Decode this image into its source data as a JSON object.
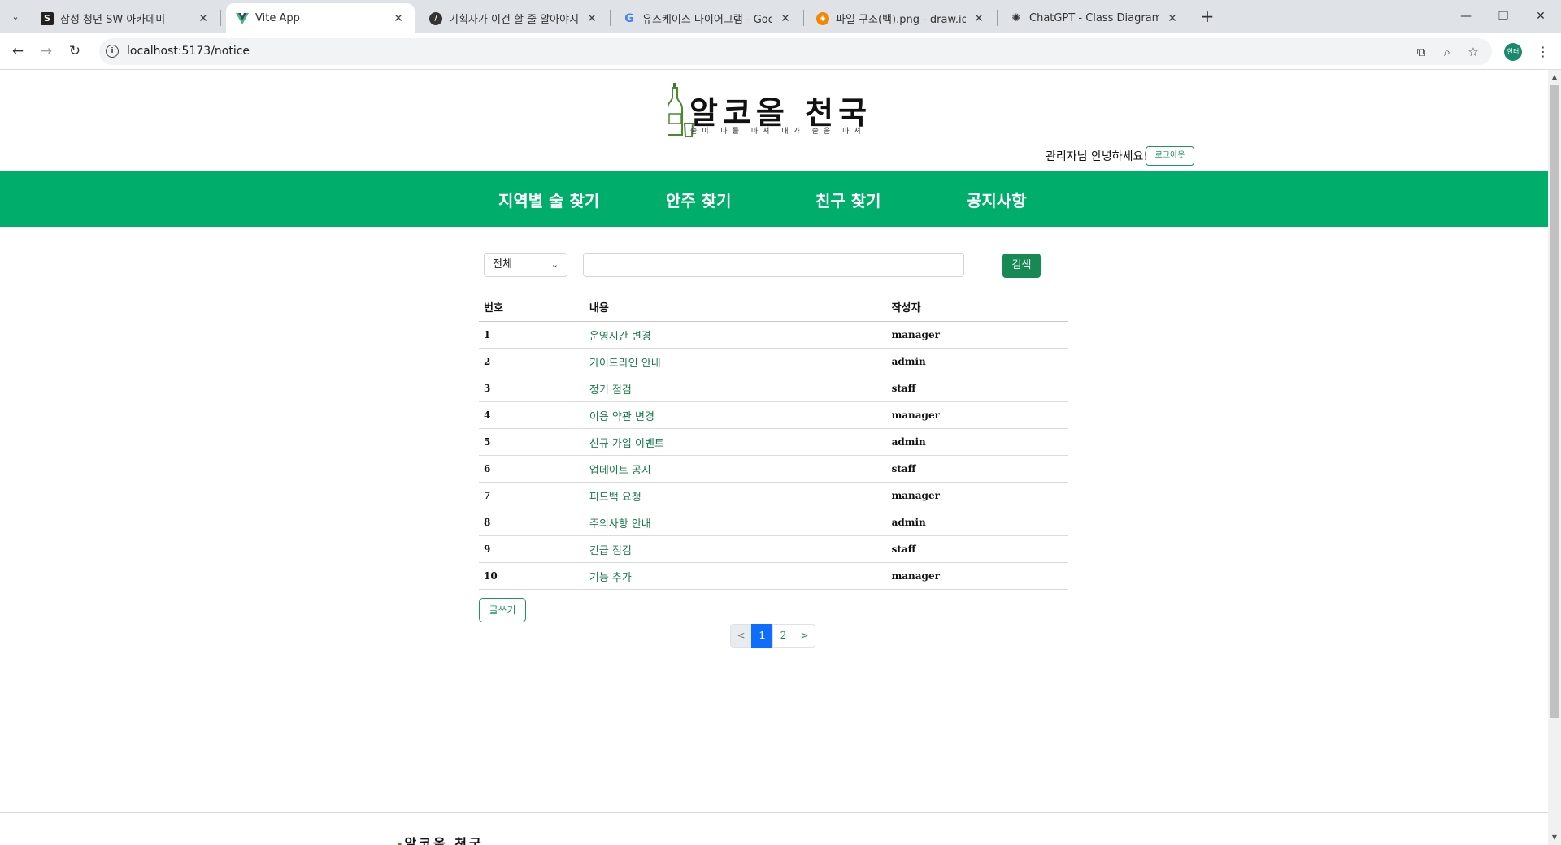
{
  "browser": {
    "tabs": [
      {
        "title": "삼성 청년 SW 아카데미",
        "favicon": "ssafy-icon"
      },
      {
        "title": "Vite App",
        "favicon": "vue-icon",
        "active": true
      },
      {
        "title": "기획자가 이건 할 줄 알아야지:",
        "favicon": "notion-icon"
      },
      {
        "title": "유즈케이스 다이어그램 - Goog",
        "favicon": "google-icon"
      },
      {
        "title": "파일 구조(백).png - draw.io",
        "favicon": "drawio-icon"
      },
      {
        "title": "ChatGPT - Class Diagram Crea",
        "favicon": "chatgpt-icon"
      }
    ],
    "url": "localhost:5173/notice",
    "profile_initials": "헌터"
  },
  "header": {
    "brand": "알코올 천국",
    "slogan": "술이 나를 마셔 내가 술을 마셔",
    "greeting": "관리자님 안녕하세요!",
    "logout_label": "로그아웃"
  },
  "nav": {
    "items": [
      "지역별 술 찾기",
      "안주 찾기",
      "친구 찾기",
      "공지사항"
    ]
  },
  "search": {
    "filter_value": "전체",
    "query": "",
    "button_label": "검색"
  },
  "table": {
    "headers": [
      "번호",
      "내용",
      "작성자"
    ],
    "rows": [
      {
        "num": "1",
        "content": "운영시간 변경",
        "writer": "manager"
      },
      {
        "num": "2",
        "content": "가이드라인 안내",
        "writer": "admin"
      },
      {
        "num": "3",
        "content": "정기 점검",
        "writer": "staff"
      },
      {
        "num": "4",
        "content": "이용 약관 변경",
        "writer": "manager"
      },
      {
        "num": "5",
        "content": "신규 가입 이벤트",
        "writer": "admin"
      },
      {
        "num": "6",
        "content": "업데이트 공지",
        "writer": "staff"
      },
      {
        "num": "7",
        "content": "피드백 요청",
        "writer": "manager"
      },
      {
        "num": "8",
        "content": "주의사항 안내",
        "writer": "admin"
      },
      {
        "num": "9",
        "content": "긴급 점검",
        "writer": "staff"
      },
      {
        "num": "10",
        "content": "기능 추가",
        "writer": "manager"
      }
    ]
  },
  "write_label": "글쓰기",
  "pagination": {
    "prev": "<",
    "pages": [
      "1",
      "2"
    ],
    "current": "1",
    "next": ">"
  },
  "footer": {
    "brand": "알코올 천국"
  },
  "colors": {
    "nav_green": "#00ad6b",
    "button_green": "#178a53",
    "link_green": "#1a7a4c",
    "page_active": "#0d6efd"
  }
}
